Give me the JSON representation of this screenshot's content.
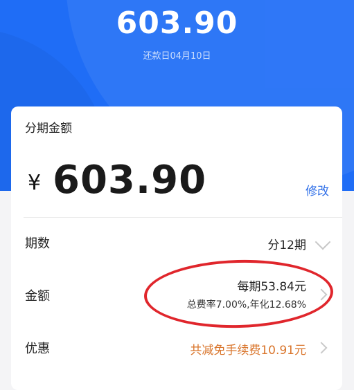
{
  "header": {
    "amount": "603.90",
    "due_date": "还款日04月10日"
  },
  "card": {
    "title": "分期金额",
    "currency_symbol": "¥",
    "amount": "603.90",
    "edit_label": "修改"
  },
  "periods": {
    "label": "期数",
    "value": "分12期"
  },
  "payment": {
    "label": "金额",
    "per_period": "每期53.84元",
    "rate_info": "总费率7.00%,年化12.68%"
  },
  "promotion": {
    "label": "优惠",
    "value": "共减免手续费10.91元"
  },
  "colors": {
    "primary_blue": "#1f6df6",
    "link_blue": "#2f6fe8",
    "promo_orange": "#d9742a",
    "annotation_red": "#e0262c"
  }
}
